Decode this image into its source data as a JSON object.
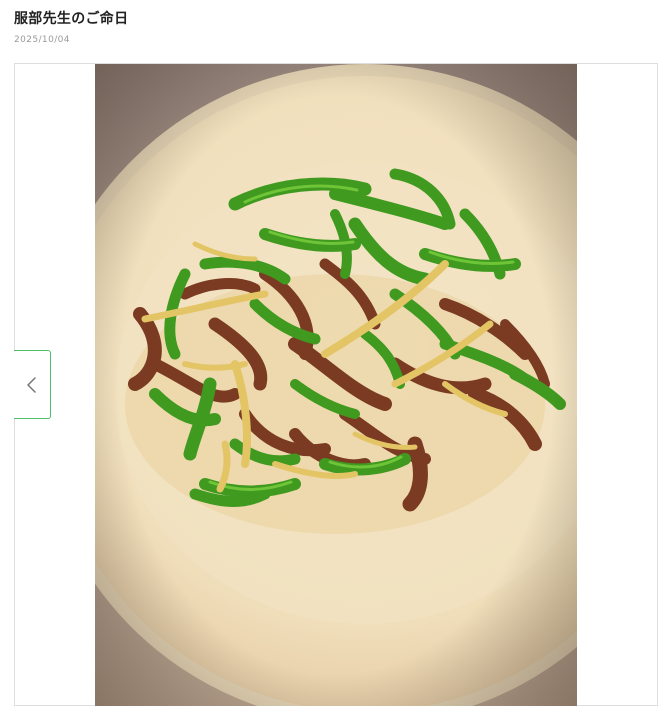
{
  "post": {
    "title": "服部先生のご命日",
    "date": "2025/10/04"
  },
  "photo": {
    "subject_icon": "food-photo"
  },
  "gallery": {
    "prev_icon": "chevron-left-icon"
  },
  "colors": {
    "accent": "#4cbf6a",
    "border": "#dedede",
    "date_text": "#9a9a9a"
  }
}
